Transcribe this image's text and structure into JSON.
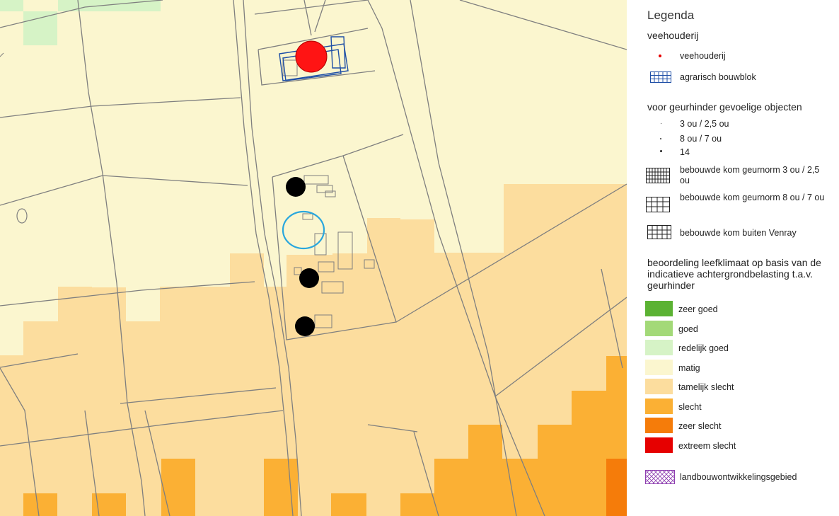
{
  "map": {
    "background": "#fbf6cf",
    "colors": {
      "zeer_goed": "#5bb233",
      "goed": "#a3d978",
      "redelijk_goed": "#d6f3c6",
      "matig": "#fbf6cf",
      "tamelijk_slecht": "#fcdd9e",
      "slecht": "#fbb034",
      "zeer_slecht": "#f57c0a",
      "extreem_slecht": "#e60000",
      "road": "#7f7f7f",
      "bouwblok": "#1f4fa6",
      "veehouderij_marker": "#ff1414",
      "object_marker": "#000000",
      "highlight_circle": "#2aa7dd"
    }
  },
  "legend": {
    "title": "Legenda",
    "veehouderij_header": "veehouderij",
    "veehouderij_item": "veehouderij",
    "bouwblok_item": "agrarisch bouwblok",
    "objects_header": "voor geurhinder gevoelige objecten",
    "objects": [
      {
        "label": "3 ou / 2,5 ou",
        "icon": "dot-small-icon"
      },
      {
        "label": "8 ou / 7 ou",
        "icon": "dot-medium-icon"
      },
      {
        "label": "14",
        "icon": "dot-large-icon"
      }
    ],
    "kom": [
      {
        "label": "bebouwde kom geurnorm 3 ou / 2,5 ou",
        "icon": "grid-dense-icon"
      },
      {
        "label": "bebouwde kom geurnorm 8 ou / 7 ou",
        "icon": "grid-medium-icon"
      },
      {
        "label": "bebouwde kom buiten Venray",
        "icon": "grid-coarse-icon"
      }
    ],
    "class_header": "beoordeling leefklimaat op basis van de indicatieve achtergrondbelasting t.a.v. geurhinder",
    "classes": [
      {
        "label": "zeer goed",
        "color": "#5bb233"
      },
      {
        "label": "goed",
        "color": "#a3d978"
      },
      {
        "label": "redelijk goed",
        "color": "#d6f3c6"
      },
      {
        "label": "matig",
        "color": "#fbf6cf"
      },
      {
        "label": "tamelijk slecht",
        "color": "#fcdd9e"
      },
      {
        "label": "slecht",
        "color": "#fbb034"
      },
      {
        "label": "zeer slecht",
        "color": "#f57c0a"
      },
      {
        "label": "extreem slecht",
        "color": "#e60000"
      }
    ],
    "ontwikkeling": "landbouwontwikkelingsgebied"
  }
}
